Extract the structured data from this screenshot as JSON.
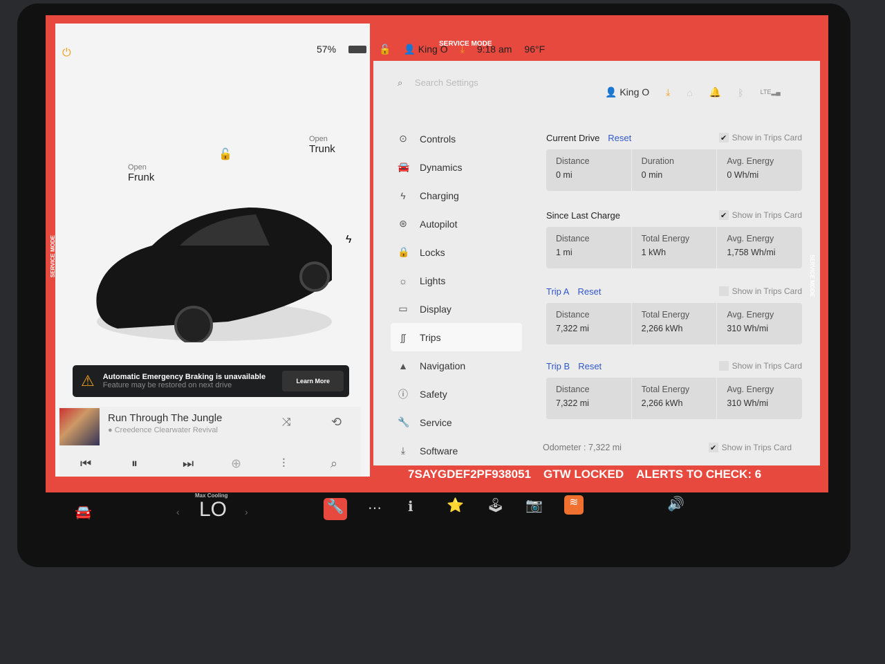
{
  "service_mode": "SERVICE MODE",
  "status": {
    "battery": "57%",
    "user": "King O",
    "time": "9:18 am",
    "temp": "96°F"
  },
  "search": {
    "placeholder": "Search Settings"
  },
  "header": {
    "user": "King O",
    "icons": [
      "download-icon",
      "home-icon",
      "bell-icon",
      "bluetooth-icon",
      "lte-signal-icon"
    ]
  },
  "menu": [
    {
      "label": "Controls",
      "icon": "toggle-icon"
    },
    {
      "label": "Dynamics",
      "icon": "car-icon"
    },
    {
      "label": "Charging",
      "icon": "bolt-icon"
    },
    {
      "label": "Autopilot",
      "icon": "steering-wheel-icon"
    },
    {
      "label": "Locks",
      "icon": "lock-icon"
    },
    {
      "label": "Lights",
      "icon": "sun-icon"
    },
    {
      "label": "Display",
      "icon": "display-icon"
    },
    {
      "label": "Trips",
      "icon": "trips-icon",
      "active": true
    },
    {
      "label": "Navigation",
      "icon": "navigation-icon"
    },
    {
      "label": "Safety",
      "icon": "safety-icon"
    },
    {
      "label": "Service",
      "icon": "wrench-icon"
    },
    {
      "label": "Software",
      "icon": "download-icon"
    }
  ],
  "trips": [
    {
      "title": "Current Drive",
      "reset": "Reset",
      "show": "Show in Trips Card",
      "checked": true,
      "cells": [
        {
          "label": "Distance",
          "value": "0 mi"
        },
        {
          "label": "Duration",
          "value": "0 min"
        },
        {
          "label": "Avg. Energy",
          "value": "0 Wh/mi"
        }
      ]
    },
    {
      "title": "Since Last Charge",
      "reset": "",
      "show": "Show in Trips Card",
      "checked": true,
      "cells": [
        {
          "label": "Distance",
          "value": "1 mi"
        },
        {
          "label": "Total Energy",
          "value": "1 kWh"
        },
        {
          "label": "Avg. Energy",
          "value": "1,758 Wh/mi"
        }
      ]
    },
    {
      "title": "Trip A",
      "reset": "Reset",
      "show": "Show in Trips Card",
      "checked": false,
      "cells": [
        {
          "label": "Distance",
          "value": "7,322 mi"
        },
        {
          "label": "Total Energy",
          "value": "2,266 kWh"
        },
        {
          "label": "Avg. Energy",
          "value": "310 Wh/mi"
        }
      ]
    },
    {
      "title": "Trip B",
      "reset": "Reset",
      "show": "Show in Trips Card",
      "checked": false,
      "cells": [
        {
          "label": "Distance",
          "value": "7,322 mi"
        },
        {
          "label": "Total Energy",
          "value": "2,266 kWh"
        },
        {
          "label": "Avg. Energy",
          "value": "310 Wh/mi"
        }
      ]
    }
  ],
  "odometer": {
    "label": "Odometer :",
    "value": "7,322 mi",
    "show": "Show in Trips Card",
    "checked": true
  },
  "car": {
    "frunk_small": "Open",
    "frunk": "Frunk",
    "trunk_small": "Open",
    "trunk": "Trunk"
  },
  "alert": {
    "title": "Automatic Emergency Braking is unavailable",
    "subtitle": "Feature may be restored on next drive",
    "button": "Learn More"
  },
  "media": {
    "song": "Run Through The Jungle",
    "artist": "Creedence Clearwater Revival"
  },
  "service_bar": {
    "vin": "7SAYGDEF2PF938051",
    "gtw": "GTW LOCKED",
    "alerts": "ALERTS TO CHECK: 6"
  },
  "climate": {
    "label": "Max Cooling",
    "value": "LO"
  },
  "colors": {
    "service_red": "#e8493f",
    "link_blue": "#3057c8",
    "accent_orange": "#f0a020"
  }
}
